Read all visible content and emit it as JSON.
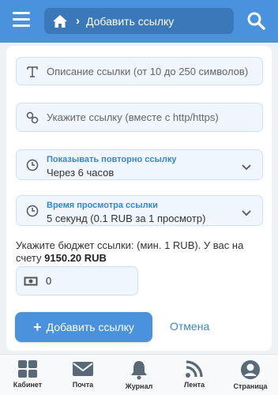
{
  "header": {
    "breadcrumb_title": "Добавить ссылку",
    "menu_icon": "hamburger-menu-icon",
    "home_icon": "home-icon",
    "search_icon": "search-icon"
  },
  "form": {
    "description_placeholder": "Описание ссылки (от 10 до 250 символов)",
    "url_placeholder": "Укажите ссылку (вместе с http/https)",
    "repeat": {
      "label": "Показывать повторно ссылку",
      "value": "Через 6 часов"
    },
    "view_time": {
      "label": "Время просмотра ссылки",
      "value": "5 секунд (0.1 RUB за 1 просмотр)"
    },
    "budget_text": "Укажите бюджет ссылки: (мин. 1 RUB). У вас на счету",
    "balance": "9150.20 RUB",
    "budget_value": "0",
    "add_button": "Добавить ссылку",
    "cancel": "Отмена"
  },
  "bottom_nav": [
    {
      "label": "Кабинет",
      "icon": "grid-icon"
    },
    {
      "label": "Почта",
      "icon": "envelope-icon"
    },
    {
      "label": "Журнал",
      "icon": "bell-icon"
    },
    {
      "label": "Лента",
      "icon": "rss-icon"
    },
    {
      "label": "Страница",
      "icon": "user-icon"
    }
  ],
  "colors": {
    "accent": "#4a93dc",
    "accent_dark": "#3a78ba",
    "field_bg": "#eff6fd",
    "link": "#3a86c8",
    "nav_icon": "#5a6978"
  }
}
